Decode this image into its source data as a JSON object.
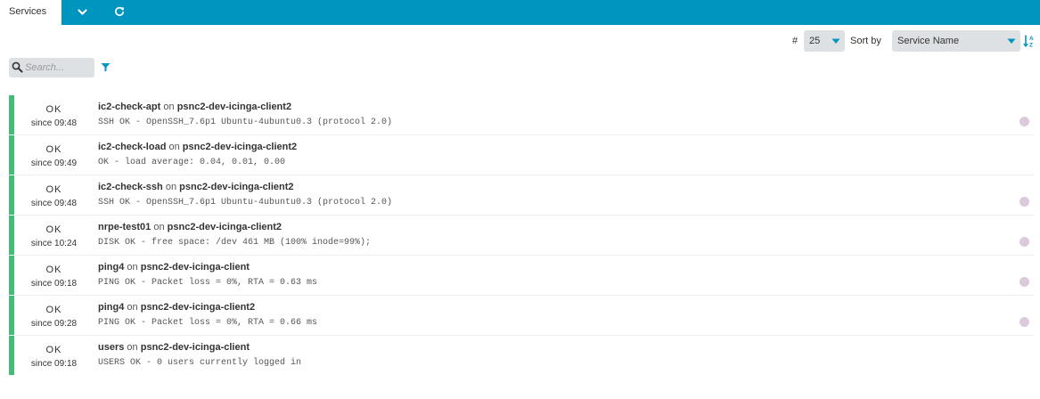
{
  "tabs": {
    "active_label": "Services"
  },
  "controls": {
    "limit_label": "#",
    "limit_value": "25",
    "sort_label": "Sort by",
    "sort_value": "Service Name",
    "search_placeholder": "Search..."
  },
  "colors": {
    "tabbar": "#0095bf",
    "state_ok": "#44bb77",
    "perfdata_dot": "#dcc9dc"
  },
  "services": [
    {
      "state": "OK",
      "since": "since 09:48",
      "service": "ic2-check-apt",
      "on": "on",
      "host": "psnc2-dev-icinga-client2",
      "output": "SSH OK - OpenSSH_7.6p1 Ubuntu-4ubuntu0.3 (protocol 2.0)",
      "perfdata": true
    },
    {
      "state": "OK",
      "since": "since 09:49",
      "service": "ic2-check-load",
      "on": "on",
      "host": "psnc2-dev-icinga-client2",
      "output": "OK - load average: 0.04, 0.01, 0.00",
      "perfdata": false
    },
    {
      "state": "OK",
      "since": "since 09:48",
      "service": "ic2-check-ssh",
      "on": "on",
      "host": "psnc2-dev-icinga-client2",
      "output": "SSH OK - OpenSSH_7.6p1 Ubuntu-4ubuntu0.3 (protocol 2.0)",
      "perfdata": true
    },
    {
      "state": "OK",
      "since": "since 10:24",
      "service": "nrpe-test01",
      "on": "on",
      "host": "psnc2-dev-icinga-client2",
      "output": "DISK OK - free space: /dev 461 MB (100% inode=99%);",
      "perfdata": true
    },
    {
      "state": "OK",
      "since": "since 09:18",
      "service": "ping4",
      "on": "on",
      "host": "psnc2-dev-icinga-client",
      "output": "PING OK - Packet loss = 0%, RTA = 0.63 ms",
      "perfdata": true
    },
    {
      "state": "OK",
      "since": "since 09:28",
      "service": "ping4",
      "on": "on",
      "host": "psnc2-dev-icinga-client2",
      "output": "PING OK - Packet loss = 0%, RTA = 0.66 ms",
      "perfdata": true
    },
    {
      "state": "OK",
      "since": "since 09:18",
      "service": "users",
      "on": "on",
      "host": "psnc2-dev-icinga-client",
      "output": "USERS OK - 0 users currently logged in",
      "perfdata": false
    }
  ]
}
